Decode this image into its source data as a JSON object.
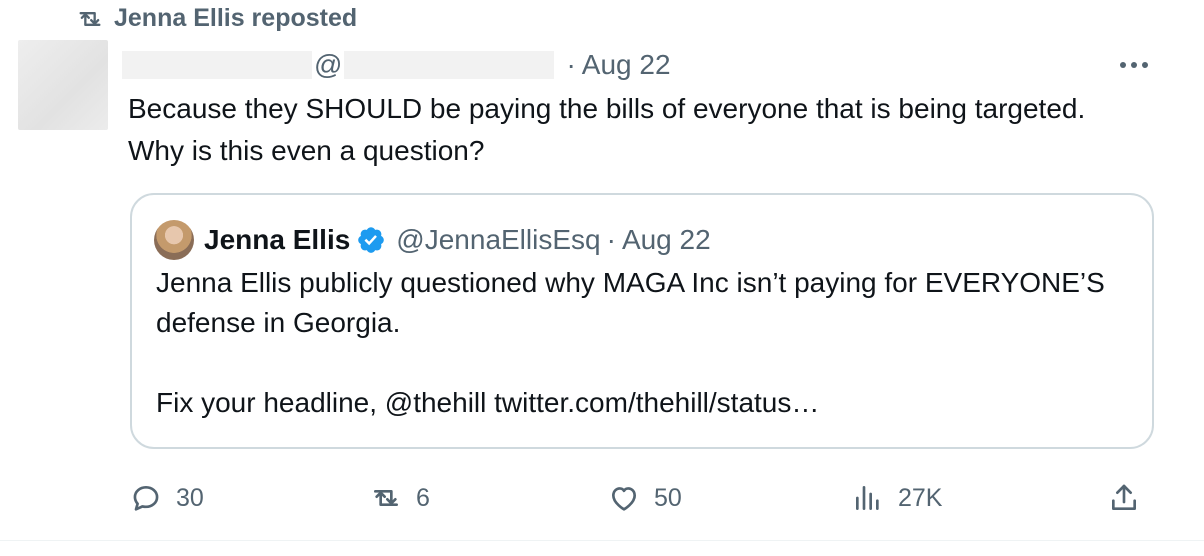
{
  "repost": {
    "label": "Jenna Ellis reposted",
    "icon": "repost-icon"
  },
  "tweet": {
    "handle_prefix": "@",
    "separator": "·",
    "date": "Aug 22",
    "text": "Because they SHOULD be paying the bills of everyone that is being targeted. Why is this even a question?"
  },
  "quote": {
    "name": "Jenna Ellis",
    "handle": "@JennaEllisEsq",
    "separator": "·",
    "date": "Aug 22",
    "line1": "Jenna Ellis publicly questioned why MAGA Inc isn’t paying for EVERYONE’S defense in Georgia.",
    "line2": "Fix your headline, @thehill twitter.com/thehill/status…"
  },
  "actions": {
    "replies": "30",
    "reposts": "6",
    "likes": "50",
    "views": "27K"
  },
  "colors": {
    "text": "#0f1419",
    "secondary": "#536471",
    "verified": "#1d9bf0",
    "border": "#cfd9de"
  }
}
